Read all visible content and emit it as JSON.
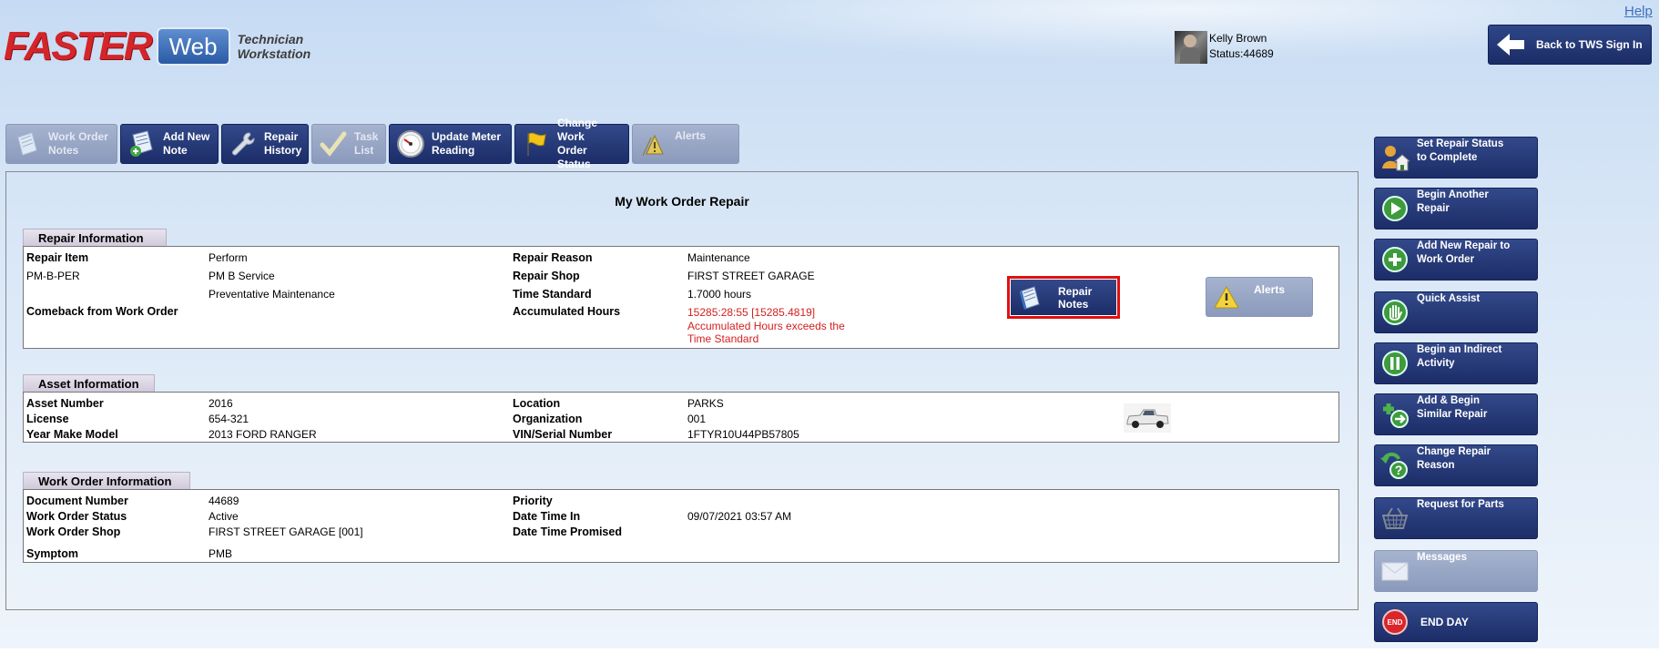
{
  "header": {
    "logo_main": "FASTER",
    "logo_web": "Web",
    "logo_sub_line1": "Technician",
    "logo_sub_line2": "Workstation",
    "help": "Help",
    "user_name": "Kelly Brown",
    "user_status": "Status:44689",
    "back_button": "Back to TWS Sign In"
  },
  "toolbar": [
    {
      "line1": "Work Order",
      "line2": "Notes",
      "enabled": false,
      "icon": "notes-icon"
    },
    {
      "line1": "Add New",
      "line2": "Note",
      "enabled": true,
      "icon": "add-note-icon"
    },
    {
      "line1": "Repair",
      "line2": "History",
      "enabled": true,
      "icon": "wrench-icon"
    },
    {
      "line1": "Task",
      "line2": "List",
      "enabled": false,
      "icon": "checkmark-icon"
    },
    {
      "line1": "Update Meter",
      "line2": "Reading",
      "enabled": true,
      "icon": "gauge-icon"
    },
    {
      "line1": "Change Work",
      "line2": "Order Status",
      "enabled": true,
      "icon": "flag-icon"
    },
    {
      "line1": "Alerts",
      "line2": "",
      "enabled": false,
      "icon": "warning-icon"
    }
  ],
  "page_title": "My Work Order Repair",
  "repair": {
    "tab": "Repair Information",
    "repair_item_label": "Repair Item",
    "repair_item_value": "Perform",
    "code": "PM-B-PER",
    "service": "PM B Service",
    "service_desc": "Preventative Maintenance",
    "comeback_label": "Comeback from Work Order",
    "reason_label": "Repair Reason",
    "reason_value": "Maintenance",
    "shop_label": "Repair Shop",
    "shop_value": "FIRST STREET GARAGE",
    "time_std_label": "Time Standard",
    "time_std_value": "1.7000 hours",
    "accum_label": "Accumulated Hours",
    "accum_value": "15285:28:55 [15285.4819]",
    "accum_warning_1": "Accumulated Hours exceeds the",
    "accum_warning_2": "Time Standard",
    "notes_button_1": "Repair",
    "notes_button_2": "Notes",
    "alerts_button": "Alerts"
  },
  "asset": {
    "tab": "Asset Information",
    "number_label": "Asset Number",
    "number_value": "2016",
    "license_label": "License",
    "license_value": "654-321",
    "ymm_label": "Year Make Model",
    "ymm_value": "2013 FORD RANGER",
    "location_label": "Location",
    "location_value": "PARKS",
    "org_label": "Organization",
    "org_value": "001",
    "vin_label": "VIN/Serial Number",
    "vin_value": "1FTYR10U44PB57805"
  },
  "work_order": {
    "tab": "Work Order Information",
    "doc_label": "Document Number",
    "doc_value": "44689",
    "status_label": "Work Order Status",
    "status_value": "Active",
    "shop_label": "Work Order Shop",
    "shop_value": "FIRST STREET GARAGE [001]",
    "symptom_label": "Symptom",
    "symptom_value": "PMB",
    "priority_label": "Priority",
    "priority_value": "",
    "date_in_label": "Date Time In",
    "date_in_value": "09/07/2021 03:57 AM",
    "date_promised_label": "Date Time Promised",
    "date_promised_value": ""
  },
  "side_buttons": [
    {
      "line1": "Set Repair Status",
      "line2": "to Complete",
      "enabled": true
    },
    {
      "line1": "Begin Another",
      "line2": "Repair",
      "enabled": true
    },
    {
      "line1": "Add New Repair to",
      "line2": "Work Order",
      "enabled": true
    },
    {
      "line1": "Quick Assist",
      "line2": "",
      "enabled": true
    },
    {
      "line1": "Begin an Indirect",
      "line2": "Activity",
      "enabled": true
    },
    {
      "line1": "Add & Begin",
      "line2": "Similar Repair",
      "enabled": true
    },
    {
      "line1": "Change Repair",
      "line2": "Reason",
      "enabled": true
    },
    {
      "line1": "Request for Parts",
      "line2": "",
      "enabled": true
    },
    {
      "line1": "Messages",
      "line2": "",
      "enabled": false
    },
    {
      "line1": "END DAY",
      "line2": "",
      "enabled": true,
      "badge": "END"
    }
  ],
  "colors": {
    "button_blue": "#1c2d68",
    "button_disabled": "#8b9abc",
    "warning_red": "#d42020",
    "highlight_red": "#e01010"
  }
}
